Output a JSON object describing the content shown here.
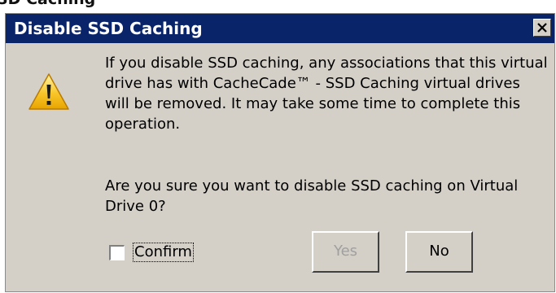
{
  "page": {
    "heading_fragment": "SD Caching"
  },
  "dialog": {
    "title": "Disable SSD Caching",
    "message": "If you disable SSD caching, any associations that this virtual drive has with CacheCade™ - SSD Caching virtual drives will be removed. It may take some time to complete this operation.",
    "question": "Are you sure you want to disable SSD caching on Virtual Drive 0?",
    "confirm_label": "Confirm",
    "confirm_checked": false,
    "buttons": {
      "yes_label": "Yes",
      "yes_enabled": false,
      "no_label": "No"
    },
    "icons": {
      "warning": "warning-icon",
      "close": "close-icon"
    },
    "colors": {
      "titlebar": "#0a246a",
      "dialog_background": "#d4d0c8",
      "disabled_text": "#a0a0a0"
    }
  }
}
